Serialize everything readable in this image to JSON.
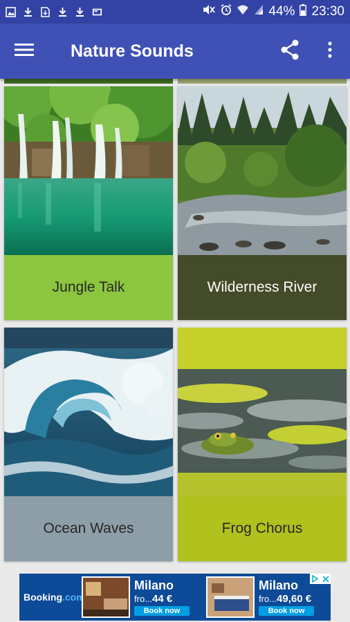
{
  "status_bar": {
    "battery_percent": "44%",
    "time": "23:30",
    "left_icons": [
      "gallery-icon",
      "download-icon",
      "download-file-icon",
      "download-icon",
      "download-icon",
      "cast-icon"
    ],
    "right_icons": [
      "mute-icon",
      "alarm-icon",
      "wifi-icon",
      "signal-icon",
      "battery-icon"
    ]
  },
  "app_bar": {
    "title": "Nature Sounds",
    "menu_icon": "hamburger-menu-icon",
    "share_icon": "share-icon",
    "overflow_icon": "more-vert-icon",
    "color": "#3f51b5"
  },
  "cards": [
    {
      "label": "Jungle Talk",
      "scene": "jungle-waterfall",
      "label_bg": "#8cc63f",
      "label_color": "#262626"
    },
    {
      "label": "Wilderness River",
      "scene": "forest-river",
      "label_bg": "#434b29",
      "label_color": "#ffffff"
    },
    {
      "label": "Ocean Waves",
      "scene": "ocean-wave",
      "label_bg": "#8e9ea8",
      "label_color": "#262626"
    },
    {
      "label": "Frog Chorus",
      "scene": "frog-lilypads",
      "label_bg": "#b1c11d",
      "label_color": "#262626"
    }
  ],
  "ad": {
    "brand": "Booking",
    "brand_suffix": ".com",
    "offers": [
      {
        "city": "Milano",
        "from": "fro...",
        "price": "44 €",
        "cta": "Book now"
      },
      {
        "city": "Milano",
        "from": "fro...",
        "price": "49,60 €",
        "cta": "Book now"
      }
    ],
    "adchoices_icon": "adchoices-icon",
    "close_icon": "close-icon"
  }
}
